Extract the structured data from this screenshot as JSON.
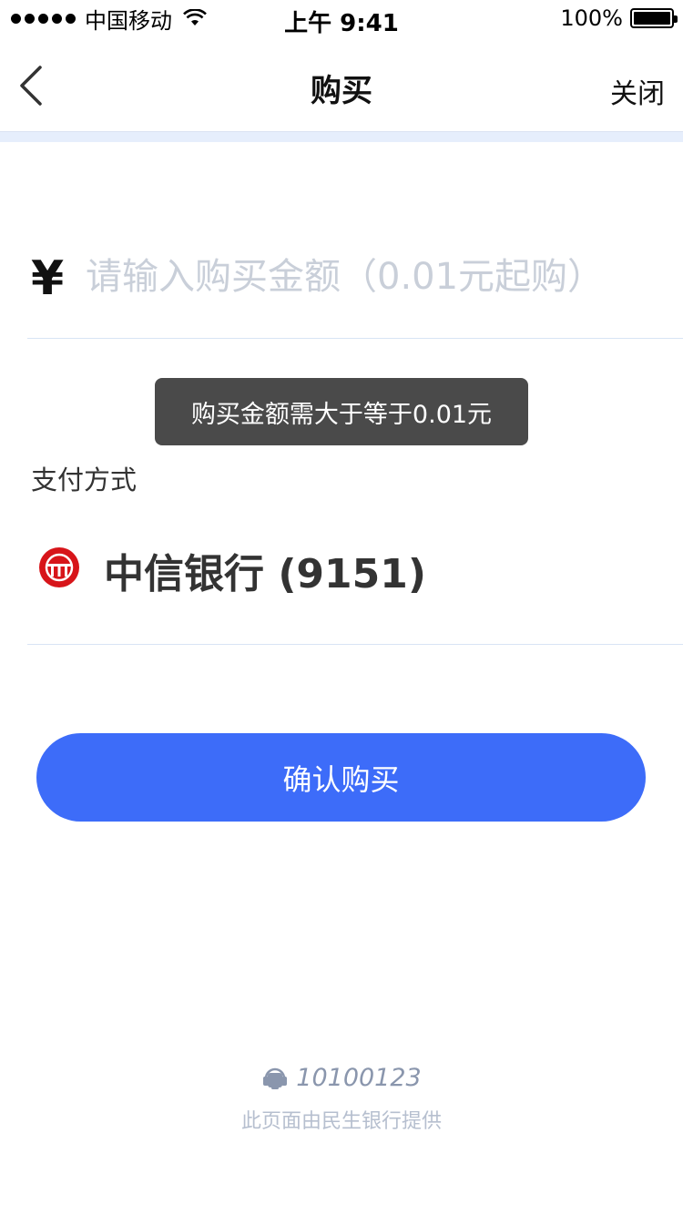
{
  "status_bar": {
    "carrier": "中国移动",
    "time": "上午 9:41",
    "battery": "100%"
  },
  "nav": {
    "title": "购买",
    "close_label": "关闭"
  },
  "amount": {
    "currency_symbol": "¥",
    "placeholder": "请输入购买金额（0.01元起购）",
    "value": ""
  },
  "toast": {
    "message": "购买金额需大于等于0.01元"
  },
  "payment": {
    "label": "支付方式",
    "bank_name": "中信银行 (9151)",
    "bank_logo_color": "#d7151a"
  },
  "confirm": {
    "label": "确认购买",
    "color": "#3d6cf9"
  },
  "footer": {
    "phone": "10100123",
    "note": "此页面由民生银行提供"
  }
}
